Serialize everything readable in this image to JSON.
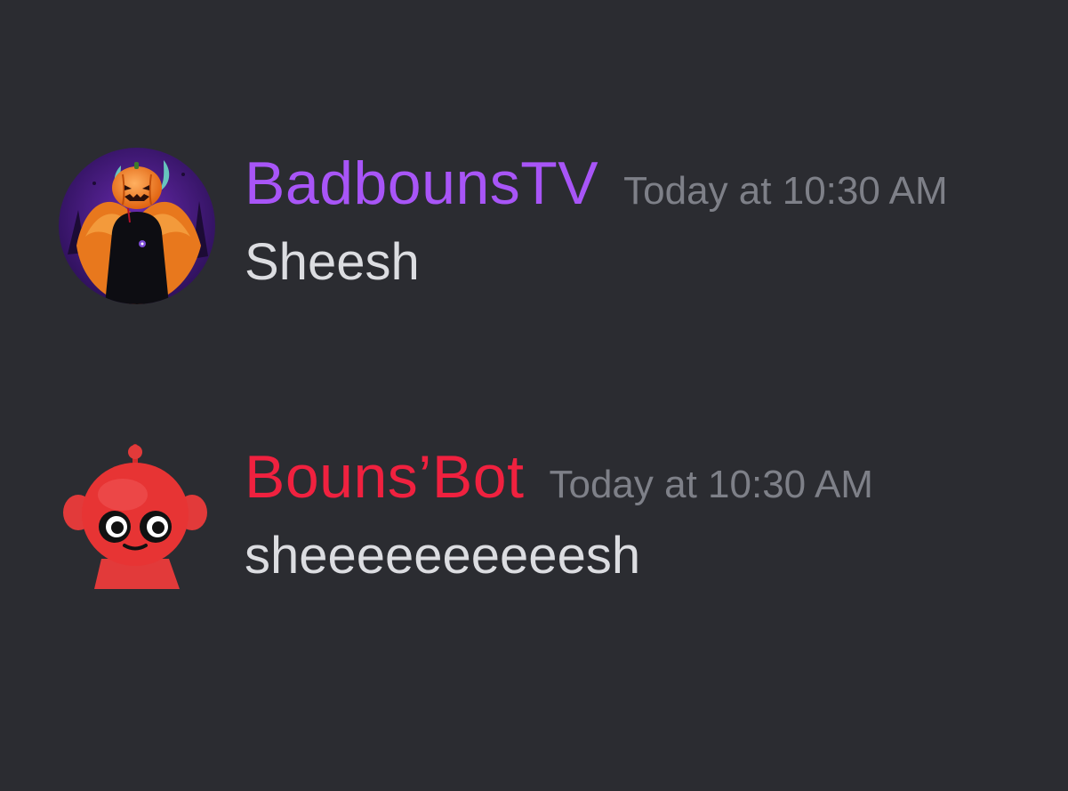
{
  "messages": [
    {
      "username": "BadbounsTV",
      "username_color": "#a855f7",
      "timestamp": "Today at 10:30 AM",
      "content": "Sheesh",
      "avatar": "halloween-pumpkin-avatar-icon"
    },
    {
      "username": "Bouns’Bot",
      "username_color": "#f0213f",
      "timestamp": "Today at 10:30 AM",
      "content": "sheeeeeeeeeesh",
      "avatar": "red-robot-avatar-icon"
    }
  ],
  "colors": {
    "background": "#2b2c31",
    "timestamp": "#7e8088",
    "message_text": "#dcdde1"
  }
}
